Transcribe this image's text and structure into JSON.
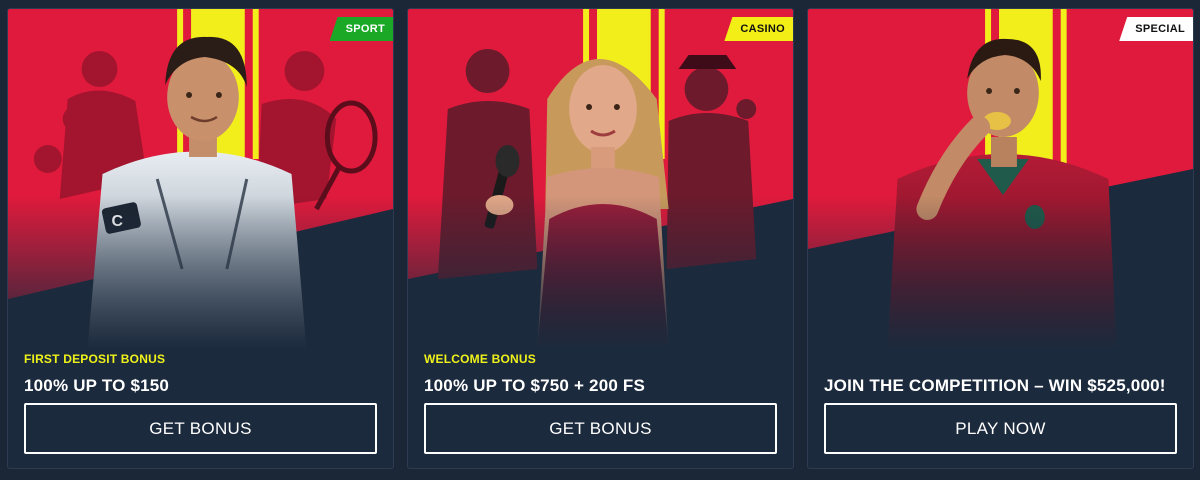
{
  "colors": {
    "page_background": "#1b2737",
    "card_background": "#1c2a3d",
    "hero_red": "#e01a3c",
    "accent_yellow": "#eff21a",
    "sport_badge_green": "#1aa826",
    "casino_badge_yellow": "#f3ef16",
    "special_badge_white": "#ffffff"
  },
  "cards": [
    {
      "badge": "SPORT",
      "subtitle": "FIRST DEPOSIT BONUS",
      "offer": "100% UP TO $150",
      "button": "GET BONUS",
      "artwork": "football player with boxer and tennis player"
    },
    {
      "badge": "CASINO",
      "subtitle": "WELCOME BONUS",
      "offer": "100% UP TO $750 + 200 FS",
      "button": "GET BONUS",
      "artwork": "woman holding microphone with two men"
    },
    {
      "badge": "SPECIAL",
      "subtitle": "",
      "offer": "JOIN THE COMPETITION – WIN $525,000!",
      "button": "PLAY NOW",
      "artwork": "football player biting gold medal"
    }
  ]
}
